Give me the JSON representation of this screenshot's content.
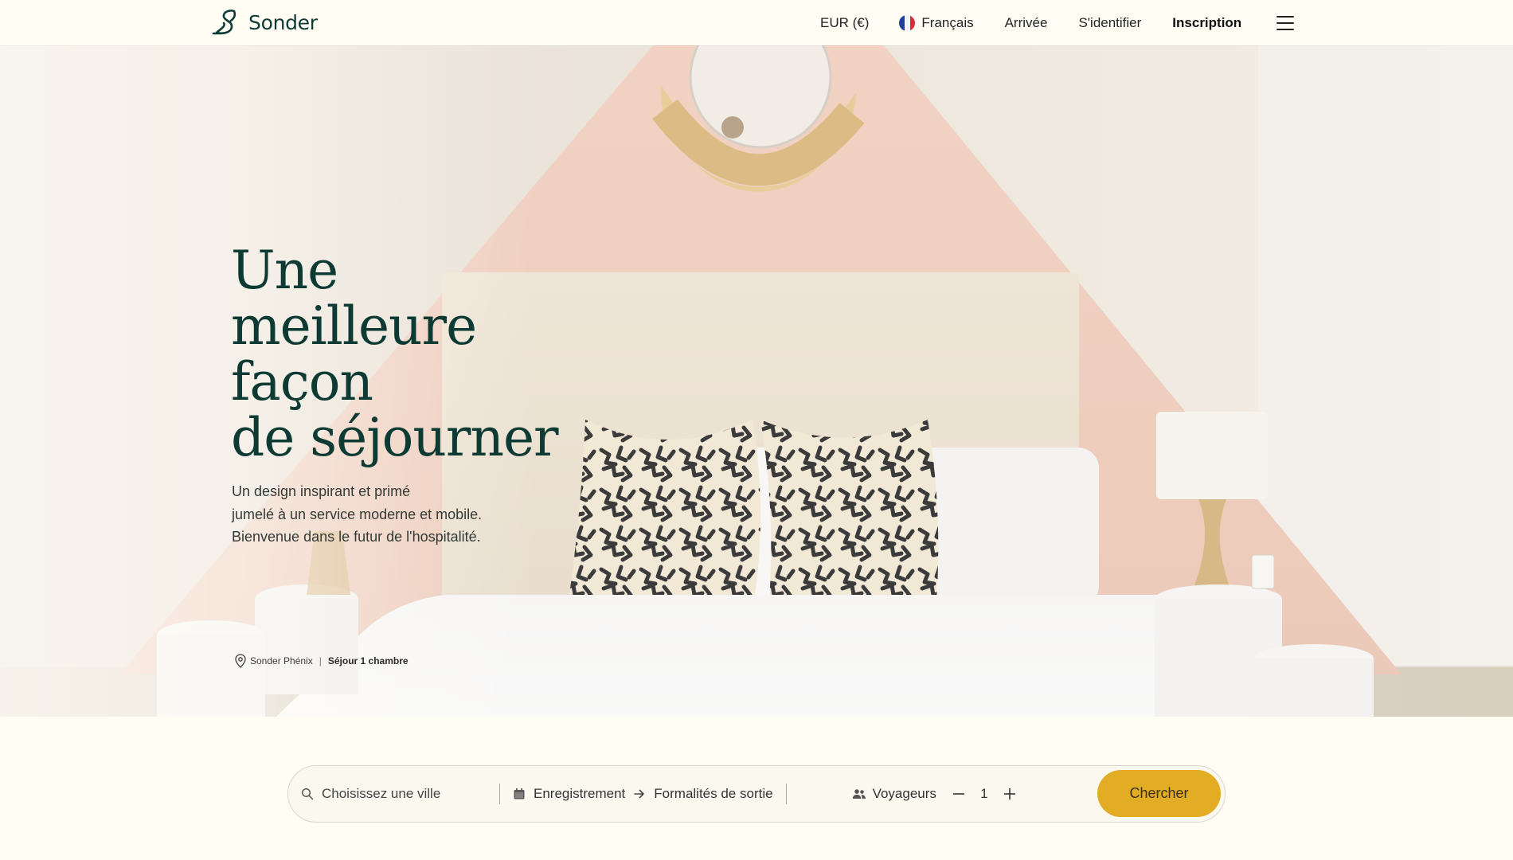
{
  "brand": {
    "name": "Sonder",
    "color": "#0d3b36"
  },
  "nav": {
    "currency": "EUR (€)",
    "language": "Français",
    "arrival": "Arrivée",
    "signin": "S'identifier",
    "signup": "Inscription",
    "menu_icon": "hamburger-icon",
    "flag_icon": "france-flag-icon"
  },
  "hero": {
    "headline_lines": [
      "Une",
      "meilleure",
      "façon",
      "de séjourner"
    ],
    "subtitle_lines": [
      "Un design inspirant et primé",
      "jumelé à un service moderne et mobile.",
      "Bienvenue dans le futur de l'hospitalité."
    ],
    "caption": {
      "location": "Sonder Phénix",
      "separator": "|",
      "stay": "Séjour 1 chambre",
      "icon": "location-pin-icon"
    }
  },
  "search": {
    "city_placeholder": "Choisissez une ville",
    "checkin_label": "Enregistrement",
    "checkout_label": "Formalités de sortie",
    "guests_label": "Voyageurs",
    "guests_count": "1",
    "button_label": "Chercher",
    "button_color": "#e2ac24",
    "icons": [
      "search-icon",
      "calendar-icon",
      "arrow-right-icon",
      "users-icon",
      "minus-icon",
      "plus-icon"
    ]
  }
}
